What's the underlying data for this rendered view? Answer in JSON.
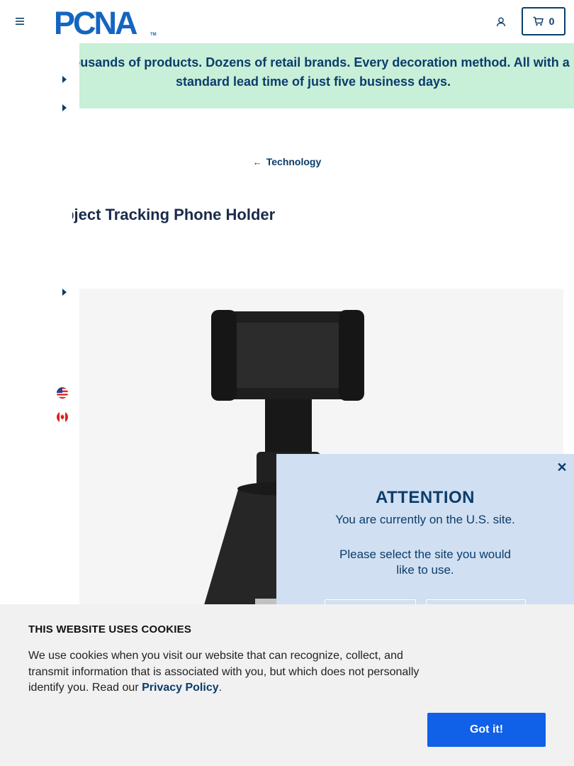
{
  "header": {
    "logo_text": "PCNA",
    "logo_tm": "TM",
    "cart_count": "0"
  },
  "banner": {
    "text": "Thousands of products. Dozens of retail brands. Every decoration method. All with a standard lead time of just five business days."
  },
  "breadcrumb": {
    "label": "Technology"
  },
  "product": {
    "title": "Object Tracking Phone Holder"
  },
  "site_modal": {
    "title": "ATTENTION",
    "line1": "You are currently on the U.S. site.",
    "line2": "Please select the site you would like to use."
  },
  "cookie_banner": {
    "title": "THIS WEBSITE USES COOKIES",
    "text_before": "We use cookies when you visit our website that can recognize, collect, and transmit information that is associated with you, but which does not personally identify you. Read our ",
    "link_text": "Privacy Policy",
    "text_after": ".",
    "button_label": "Got it!"
  },
  "colors": {
    "brand_navy": "#0b3d6b",
    "banner_bg": "#c8efd8",
    "modal_bg": "#d0dff1",
    "accept_button": "#1060e8"
  }
}
